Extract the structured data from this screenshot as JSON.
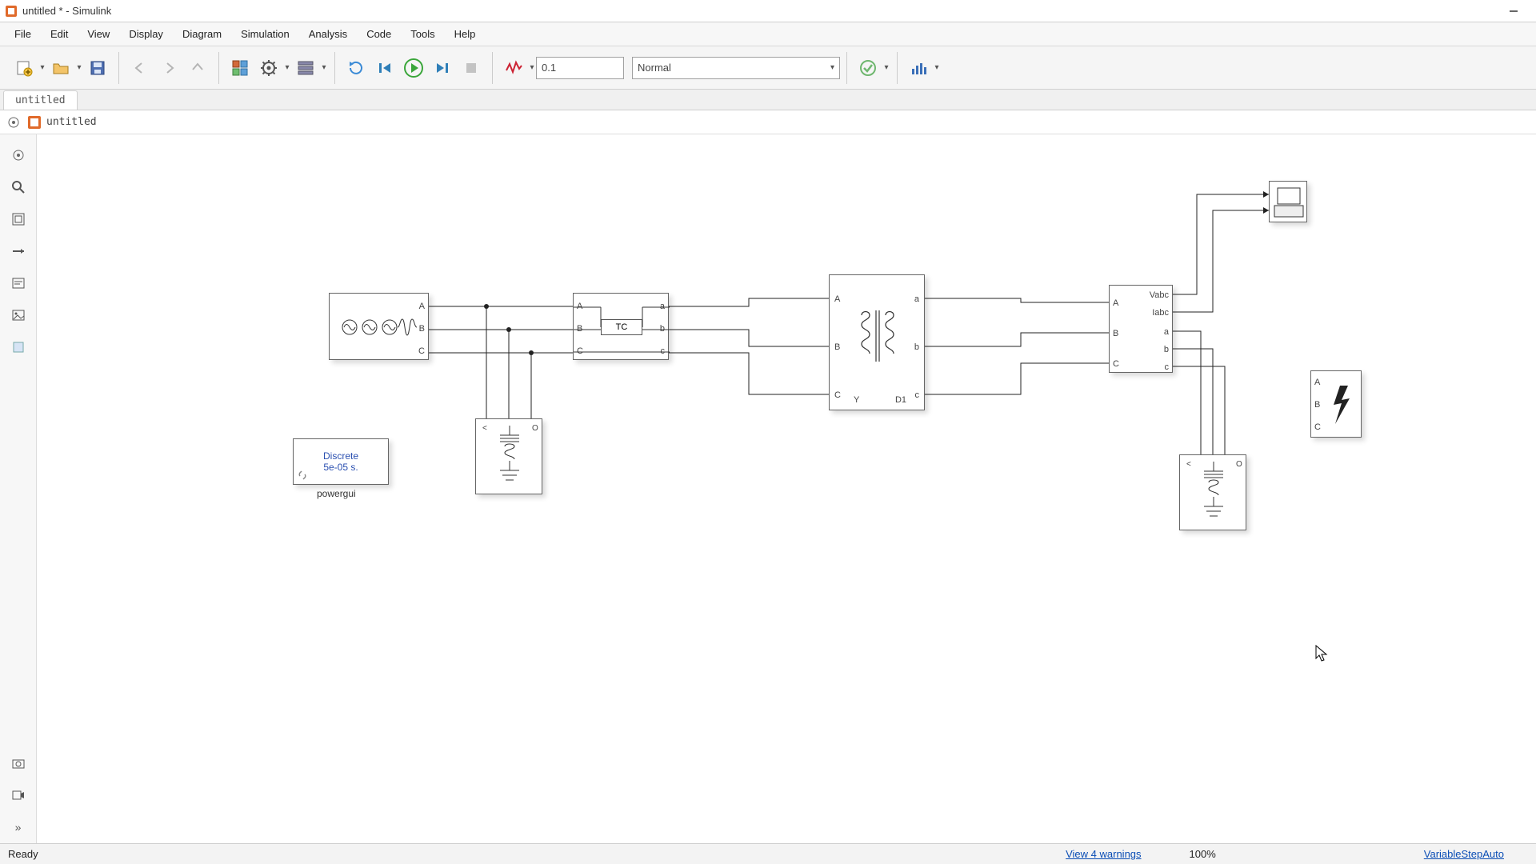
{
  "window": {
    "title": "untitled * - Simulink"
  },
  "menu": {
    "file": "File",
    "edit": "Edit",
    "view": "View",
    "display": "Display",
    "diagram": "Diagram",
    "simulation": "Simulation",
    "analysis": "Analysis",
    "code": "Code",
    "tools": "Tools",
    "help": "Help"
  },
  "toolbar": {
    "stop_time": "0.1",
    "mode": "Normal"
  },
  "tabs": {
    "t0": "untitled"
  },
  "breadcrumb": {
    "model": "untitled"
  },
  "blocks": {
    "powergui_line1": "Discrete",
    "powergui_line2": "5e-05 s.",
    "powergui_label": "powergui",
    "source_A": "A",
    "source_B": "B",
    "source_C": "C",
    "tcsc_A": "A",
    "tcsc_B": "B",
    "tcsc_C": "C",
    "tcsc_a": "a",
    "tcsc_b": "b",
    "tcsc_c": "c",
    "tcsc_text": "TC",
    "xfmr_A": "A",
    "xfmr_B": "B",
    "xfmr_C": "C",
    "xfmr_a": "a",
    "xfmr_b": "b",
    "xfmr_c": "c",
    "xfmr_Y": "Y",
    "xfmr_D1": "D1",
    "meas_A": "A",
    "meas_B": "B",
    "meas_C": "C",
    "meas_Vabc": "Vabc",
    "meas_Iabc": "Iabc",
    "meas_a": "a",
    "meas_b": "b",
    "meas_c": "c",
    "fault_A": "A",
    "fault_B": "B",
    "fault_C": "C"
  },
  "status": {
    "ready": "Ready",
    "warnings": "View 4 warnings",
    "zoom": "100%",
    "solver": "VariableStepAuto"
  }
}
